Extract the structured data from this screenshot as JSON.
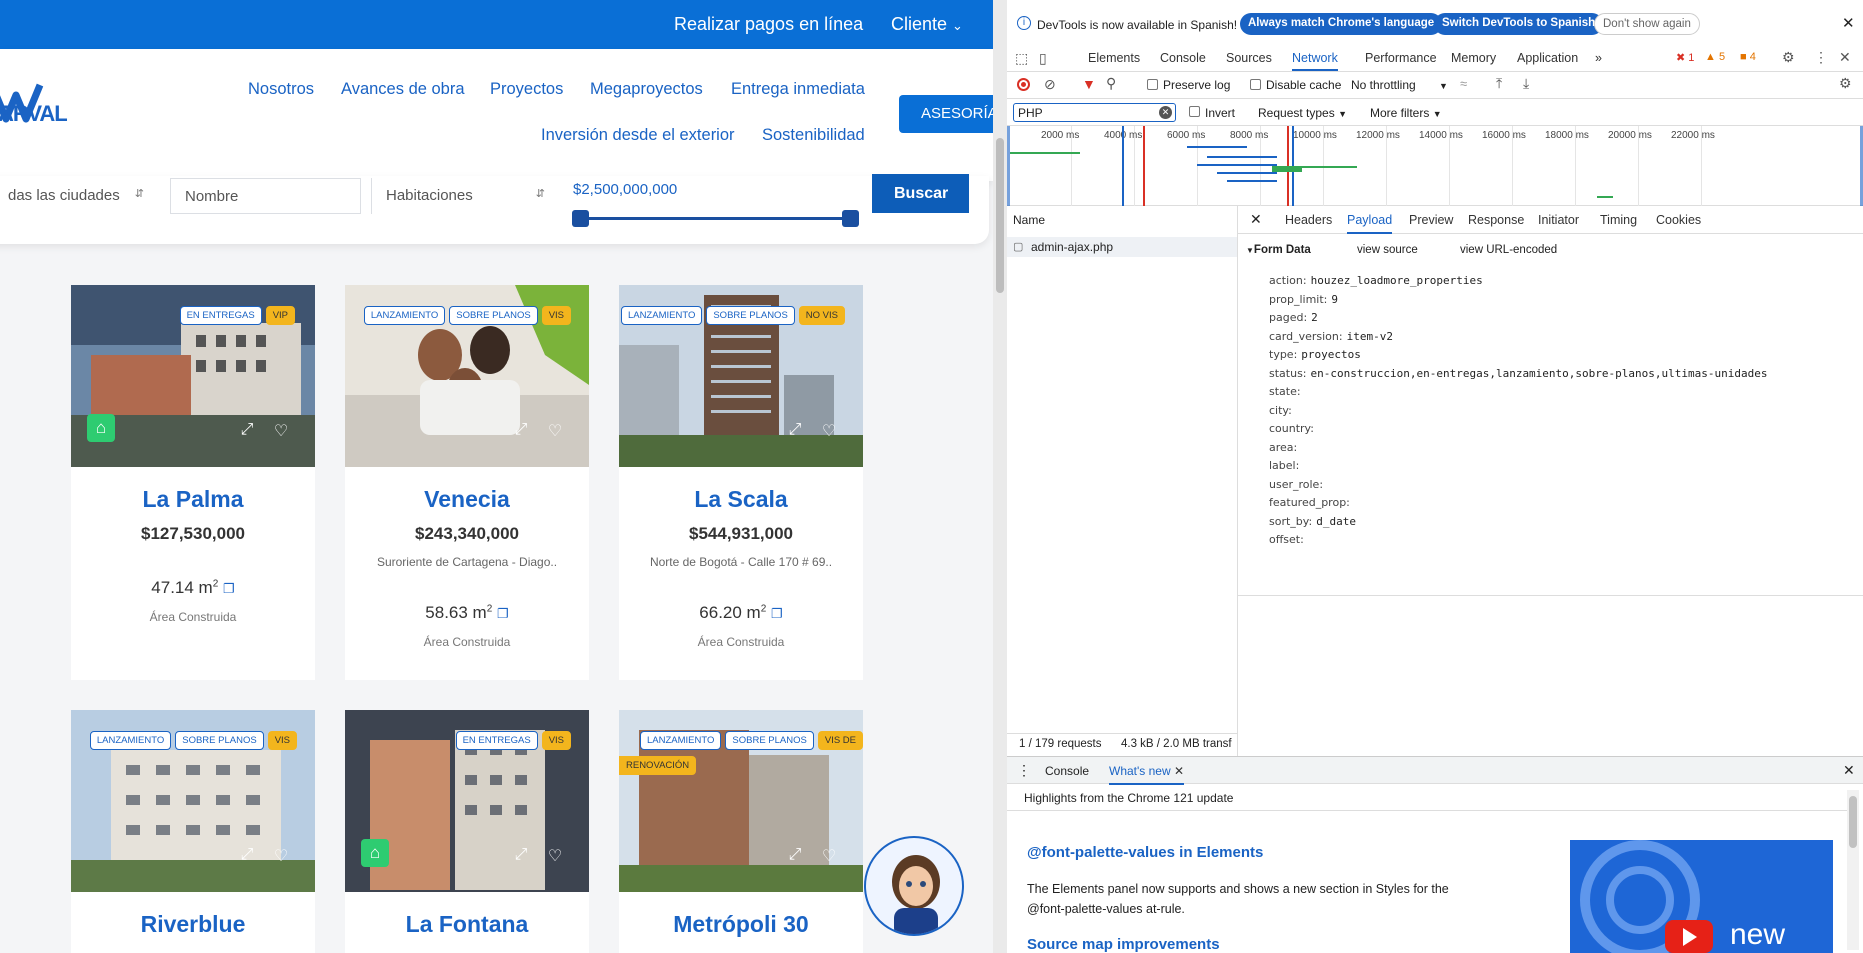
{
  "site": {
    "topbar": {
      "pay_label": "Realizar pagos en línea",
      "client_label": "Cliente"
    },
    "logo_text": "ARVAL",
    "nav": [
      "Nosotros",
      "Avances de obra",
      "Proyectos",
      "Megaproyectos",
      "Entrega inmediata",
      "Inversión desde el exterior",
      "Sostenibilidad"
    ],
    "cta_label": "ASESORÍA",
    "search": {
      "city": "das las ciudades",
      "name_placeholder": "Nombre",
      "rooms": "Habitaciones",
      "price": "$2,500,000,000",
      "button": "Buscar"
    },
    "cards": [
      {
        "title": "La Palma",
        "price": "$127,530,000",
        "address": "",
        "area": "47.14 m",
        "area_label": "Área Construida",
        "badges": [
          "EN ENTREGAS",
          "VIP"
        ],
        "home_icon": true
      },
      {
        "title": "Venecia",
        "price": "$243,340,000",
        "address": "Suroriente de Cartagena - Diago..",
        "area": "58.63 m",
        "area_label": "Área Construida",
        "badges": [
          "LANZAMIENTO",
          "SOBRE PLANOS",
          "VIS"
        ],
        "home_icon": false
      },
      {
        "title": "La Scala",
        "price": "$544,931,000",
        "address": "Norte de Bogotá - Calle 170 # 69..",
        "area": "66.20 m",
        "area_label": "Área Construida",
        "badges": [
          "LANZAMIENTO",
          "SOBRE PLANOS",
          "NO VIS"
        ],
        "home_icon": false
      },
      {
        "title": "Riverblue",
        "badges": [
          "LANZAMIENTO",
          "SOBRE PLANOS",
          "VIS"
        ],
        "home_icon": false
      },
      {
        "title": "La Fontana",
        "badges": [
          "EN ENTREGAS",
          "VIS"
        ],
        "home_icon": true
      },
      {
        "title": "Metrópoli 30",
        "badges": [
          "LANZAMIENTO",
          "SOBRE PLANOS",
          "VIS DE",
          "RENOVACIÓN"
        ],
        "home_icon": false
      }
    ],
    "sup2": "2"
  },
  "devtools": {
    "info": {
      "text": "DevTools is now available in Spanish!",
      "btn1": "Always match Chrome's language",
      "btn2": "Switch DevTools to Spanish",
      "btn3": "Don't show again"
    },
    "tabs": [
      "Elements",
      "Console",
      "Sources",
      "Network",
      "Performance",
      "Memory",
      "Application"
    ],
    "counts": {
      "errors": "1",
      "warnings": "5",
      "issues": "4"
    },
    "toolbar": {
      "preserve_log": "Preserve log",
      "disable_cache": "Disable cache",
      "throttling": "No throttling"
    },
    "filter": {
      "value": "PHP",
      "invert": "Invert",
      "request_types": "Request types",
      "more_filters": "More filters"
    },
    "ticks": [
      "2000 ms",
      "4000 ms",
      "6000 ms",
      "8000 ms",
      "10000 ms",
      "12000 ms",
      "14000 ms",
      "16000 ms",
      "18000 ms",
      "20000 ms",
      "22000 ms"
    ],
    "name_header": "Name",
    "request": "admin-ajax.php",
    "detail_tabs": [
      "Headers",
      "Payload",
      "Preview",
      "Response",
      "Initiator",
      "Timing",
      "Cookies"
    ],
    "form_data": {
      "title": "Form Data",
      "view_source": "view source",
      "view_url": "view URL-encoded",
      "rows": [
        {
          "k": "action:",
          "v": "houzez_loadmore_properties"
        },
        {
          "k": "prop_limit:",
          "v": "9"
        },
        {
          "k": "paged:",
          "v": "2"
        },
        {
          "k": "card_version:",
          "v": "item-v2"
        },
        {
          "k": "type:",
          "v": "proyectos"
        },
        {
          "k": "status:",
          "v": "en-construccion,en-entregas,lanzamiento,sobre-planos,ultimas-unidades"
        },
        {
          "k": "state:",
          "v": ""
        },
        {
          "k": "city:",
          "v": ""
        },
        {
          "k": "country:",
          "v": ""
        },
        {
          "k": "area:",
          "v": ""
        },
        {
          "k": "label:",
          "v": ""
        },
        {
          "k": "user_role:",
          "v": ""
        },
        {
          "k": "featured_prop:",
          "v": ""
        },
        {
          "k": "sort_by:",
          "v": "d_date"
        },
        {
          "k": "offset:",
          "v": ""
        }
      ]
    },
    "status": {
      "requests": "1 / 179 requests",
      "transfer": "4.3 kB / 2.0 MB transf"
    },
    "drawer": {
      "console": "Console",
      "whats_new": "What's new"
    },
    "whats_new": {
      "highlights": "Highlights from the Chrome 121 update",
      "h1": "@font-palette-values in Elements",
      "p1": "The Elements panel now supports and shows a new section in Styles for the @font-palette-values at-rule.",
      "h2": "Source map improvements",
      "video_text": "new"
    }
  }
}
